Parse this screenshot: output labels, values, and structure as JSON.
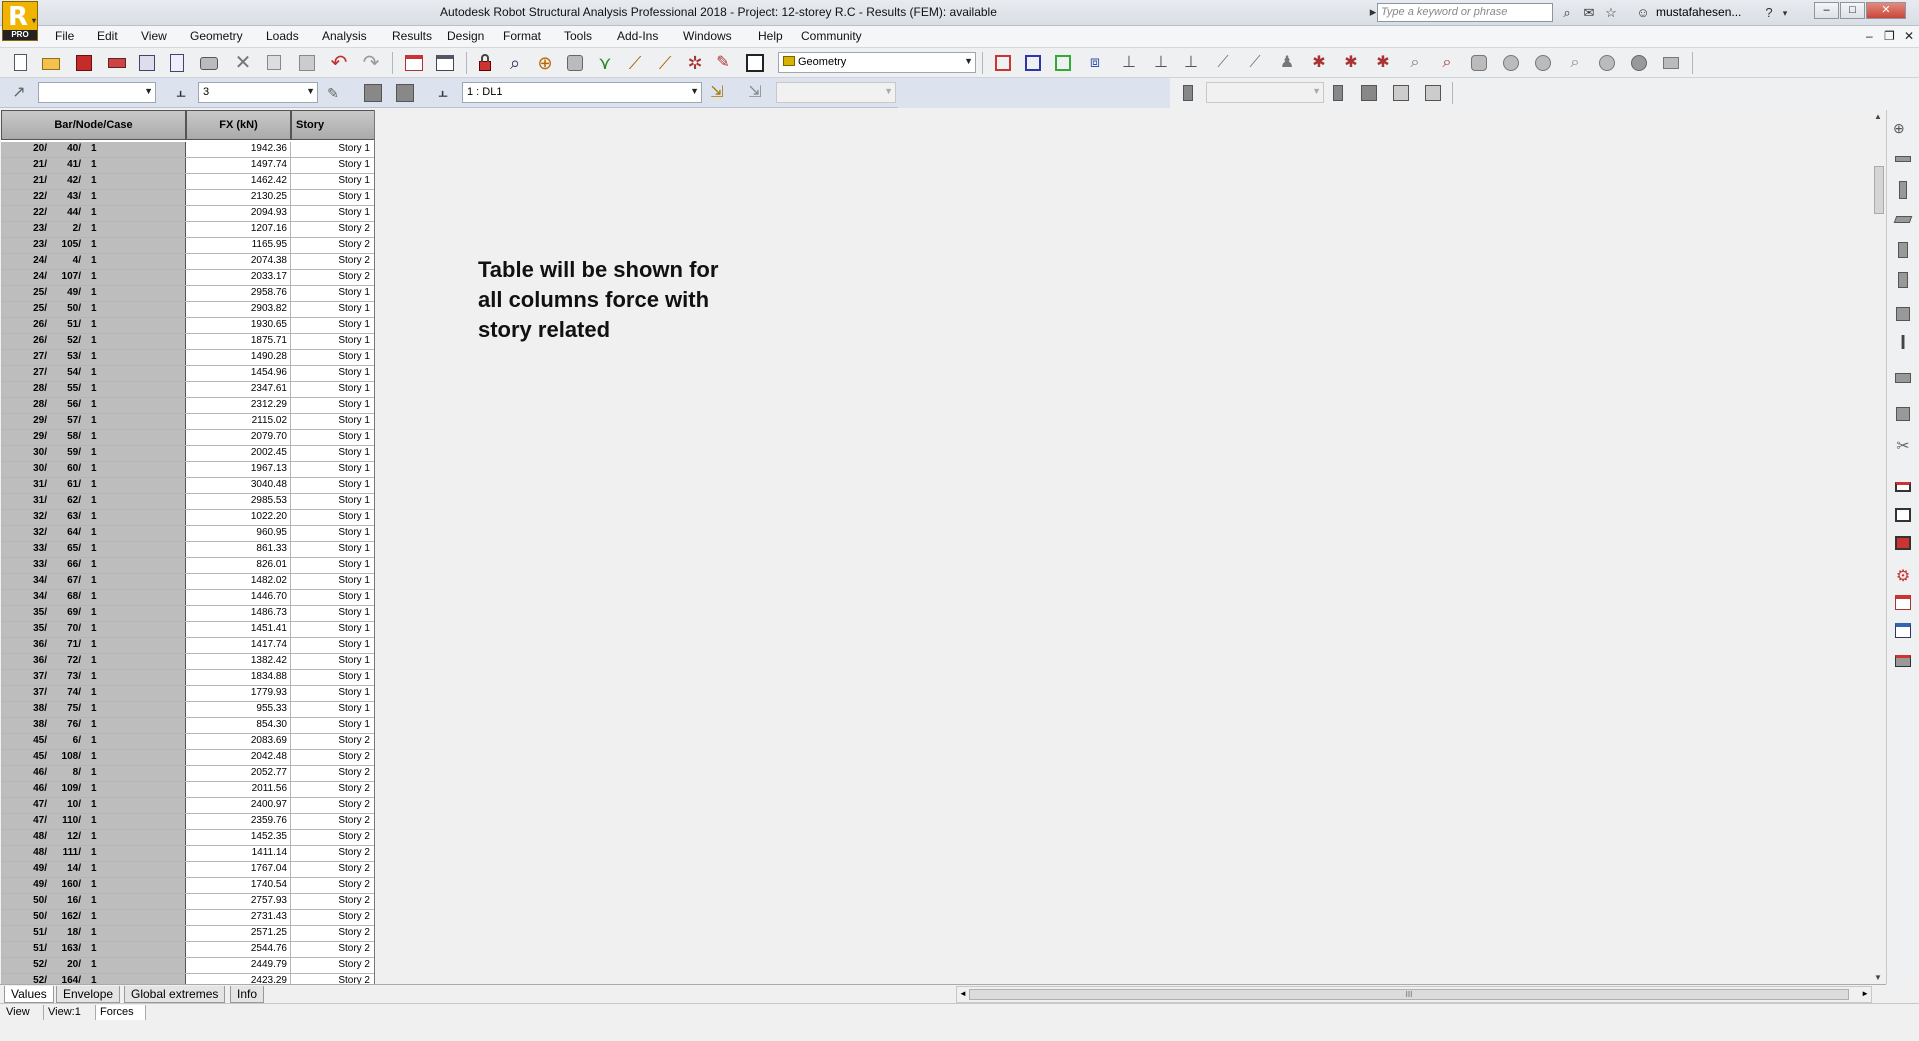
{
  "window": {
    "title": "Autodesk Robot Structural Analysis Professional 2018 - Project: 12-storey R.C - Results (FEM): available",
    "logo_text": "PRO",
    "search_placeholder": "Type a keyword or phrase",
    "username": "mustafahesen...",
    "controls": {
      "minimize": "–",
      "restore": "□",
      "close": "✕"
    }
  },
  "menu": {
    "items": [
      "File",
      "Edit",
      "View",
      "Geometry",
      "Loads",
      "Analysis",
      "Results",
      "Design",
      "Format",
      "Tools",
      "Add-Ins",
      "Windows",
      "Help",
      "Community"
    ]
  },
  "toolbar1": {
    "layout_combo": "Geometry"
  },
  "toolbar2": {
    "story_combo": "3",
    "case_combo": "1 : DL1",
    "empty_combo_1": "",
    "empty_combo_2": "",
    "empty_combo_3": ""
  },
  "table": {
    "headers": {
      "bar_node_case": "Bar/Node/Case",
      "fx": "FX (kN)",
      "story": "Story"
    },
    "rows": [
      [
        "20/",
        "40/",
        "1",
        "1942.36",
        "Story 1"
      ],
      [
        "21/",
        "41/",
        "1",
        "1497.74",
        "Story 1"
      ],
      [
        "21/",
        "42/",
        "1",
        "1462.42",
        "Story 1"
      ],
      [
        "22/",
        "43/",
        "1",
        "2130.25",
        "Story 1"
      ],
      [
        "22/",
        "44/",
        "1",
        "2094.93",
        "Story 1"
      ],
      [
        "23/",
        "2/",
        "1",
        "1207.16",
        "Story 2"
      ],
      [
        "23/",
        "105/",
        "1",
        "1165.95",
        "Story 2"
      ],
      [
        "24/",
        "4/",
        "1",
        "2074.38",
        "Story 2"
      ],
      [
        "24/",
        "107/",
        "1",
        "2033.17",
        "Story 2"
      ],
      [
        "25/",
        "49/",
        "1",
        "2958.76",
        "Story 1"
      ],
      [
        "25/",
        "50/",
        "1",
        "2903.82",
        "Story 1"
      ],
      [
        "26/",
        "51/",
        "1",
        "1930.65",
        "Story 1"
      ],
      [
        "26/",
        "52/",
        "1",
        "1875.71",
        "Story 1"
      ],
      [
        "27/",
        "53/",
        "1",
        "1490.28",
        "Story 1"
      ],
      [
        "27/",
        "54/",
        "1",
        "1454.96",
        "Story 1"
      ],
      [
        "28/",
        "55/",
        "1",
        "2347.61",
        "Story 1"
      ],
      [
        "28/",
        "56/",
        "1",
        "2312.29",
        "Story 1"
      ],
      [
        "29/",
        "57/",
        "1",
        "2115.02",
        "Story 1"
      ],
      [
        "29/",
        "58/",
        "1",
        "2079.70",
        "Story 1"
      ],
      [
        "30/",
        "59/",
        "1",
        "2002.45",
        "Story 1"
      ],
      [
        "30/",
        "60/",
        "1",
        "1967.13",
        "Story 1"
      ],
      [
        "31/",
        "61/",
        "1",
        "3040.48",
        "Story 1"
      ],
      [
        "31/",
        "62/",
        "1",
        "2985.53",
        "Story 1"
      ],
      [
        "32/",
        "63/",
        "1",
        "1022.20",
        "Story 1"
      ],
      [
        "32/",
        "64/",
        "1",
        "960.95",
        "Story 1"
      ],
      [
        "33/",
        "65/",
        "1",
        "861.33",
        "Story 1"
      ],
      [
        "33/",
        "66/",
        "1",
        "826.01",
        "Story 1"
      ],
      [
        "34/",
        "67/",
        "1",
        "1482.02",
        "Story 1"
      ],
      [
        "34/",
        "68/",
        "1",
        "1446.70",
        "Story 1"
      ],
      [
        "35/",
        "69/",
        "1",
        "1486.73",
        "Story 1"
      ],
      [
        "35/",
        "70/",
        "1",
        "1451.41",
        "Story 1"
      ],
      [
        "36/",
        "71/",
        "1",
        "1417.74",
        "Story 1"
      ],
      [
        "36/",
        "72/",
        "1",
        "1382.42",
        "Story 1"
      ],
      [
        "37/",
        "73/",
        "1",
        "1834.88",
        "Story 1"
      ],
      [
        "37/",
        "74/",
        "1",
        "1779.93",
        "Story 1"
      ],
      [
        "38/",
        "75/",
        "1",
        "955.33",
        "Story 1"
      ],
      [
        "38/",
        "76/",
        "1",
        "854.30",
        "Story 1"
      ],
      [
        "45/",
        "6/",
        "1",
        "2083.69",
        "Story 2"
      ],
      [
        "45/",
        "108/",
        "1",
        "2042.48",
        "Story 2"
      ],
      [
        "46/",
        "8/",
        "1",
        "2052.77",
        "Story 2"
      ],
      [
        "46/",
        "109/",
        "1",
        "2011.56",
        "Story 2"
      ],
      [
        "47/",
        "10/",
        "1",
        "2400.97",
        "Story 2"
      ],
      [
        "47/",
        "110/",
        "1",
        "2359.76",
        "Story 2"
      ],
      [
        "48/",
        "12/",
        "1",
        "1452.35",
        "Story 2"
      ],
      [
        "48/",
        "111/",
        "1",
        "1411.14",
        "Story 2"
      ],
      [
        "49/",
        "14/",
        "1",
        "1767.04",
        "Story 2"
      ],
      [
        "49/",
        "160/",
        "1",
        "1740.54",
        "Story 2"
      ],
      [
        "50/",
        "16/",
        "1",
        "2757.93",
        "Story 2"
      ],
      [
        "50/",
        "162/",
        "1",
        "2731.43",
        "Story 2"
      ],
      [
        "51/",
        "18/",
        "1",
        "2571.25",
        "Story 2"
      ],
      [
        "51/",
        "163/",
        "1",
        "2544.76",
        "Story 2"
      ],
      [
        "52/",
        "20/",
        "1",
        "2449.79",
        "Story 2"
      ],
      [
        "52/",
        "164/",
        "1",
        "2423.29",
        "Story 2"
      ]
    ]
  },
  "annotation": "Table will be shown for all columns force with story related",
  "bottom_tabs": [
    "Values",
    "Envelope",
    "Global extremes",
    "Info"
  ],
  "status_bar": {
    "view": "View",
    "view_number": "View:1",
    "forces": "Forces"
  },
  "scrollbar": {
    "grip": "III"
  }
}
